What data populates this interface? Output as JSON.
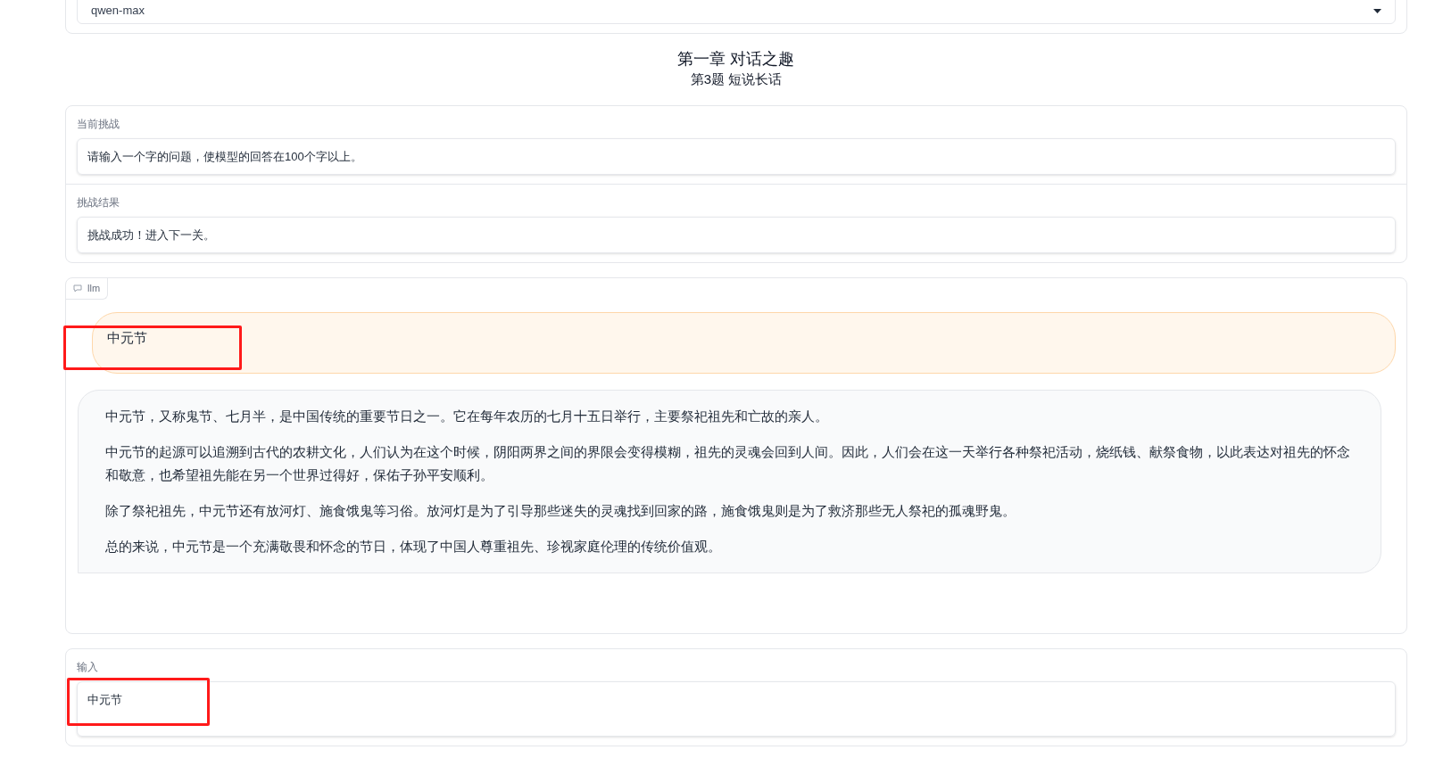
{
  "model_select": {
    "value": "qwen-max"
  },
  "chapter": {
    "title": "第一章 对话之趣",
    "subtitle": "第3题 短说长话"
  },
  "challenge": [
    {
      "label": "当前挑战",
      "value": "请输入一个字的问题，使模型的回答在100个字以上。"
    },
    {
      "label": "挑战结果",
      "value": "挑战成功！进入下一关。"
    }
  ],
  "chat": {
    "label": "llm",
    "messages": [
      {
        "kind": "user",
        "highlighted": true,
        "paragraphs": [
          "中元节"
        ]
      },
      {
        "kind": "bot",
        "highlighted": false,
        "paragraphs": [
          "中元节，又称鬼节、七月半，是中国传统的重要节日之一。它在每年农历的七月十五日举行，主要祭祀祖先和亡故的亲人。",
          "中元节的起源可以追溯到古代的农耕文化，人们认为在这个时候，阴阳两界之间的界限会变得模糊，祖先的灵魂会回到人间。因此，人们会在这一天举行各种祭祀活动，烧纸钱、献祭食物，以此表达对祖先的怀念和敬意，也希望祖先能在另一个世界过得好，保佑子孙平安顺利。",
          "除了祭祀祖先，中元节还有放河灯、施食饿鬼等习俗。放河灯是为了引导那些迷失的灵魂找到回家的路，施食饿鬼则是为了救济那些无人祭祀的孤魂野鬼。",
          "总的来说，中元节是一个充满敬畏和怀念的节日，体现了中国人尊重祖先、珍视家庭伦理的传统价值观。"
        ]
      }
    ]
  },
  "input": {
    "label": "输入",
    "value": "中元节",
    "highlighted": true
  }
}
